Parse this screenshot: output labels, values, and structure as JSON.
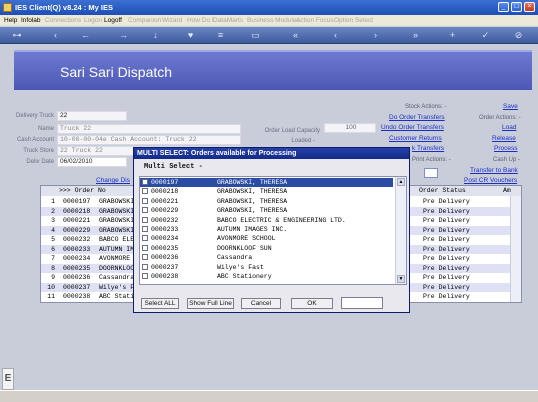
{
  "window": {
    "title": "IES Client(Q) v8.24 : My IES"
  },
  "menu": [
    {
      "label": "Help",
      "enabled": true
    },
    {
      "label": "Infolab",
      "enabled": true
    },
    {
      "label": "Connections",
      "enabled": false
    },
    {
      "label": "Logon",
      "enabled": false
    },
    {
      "label": "Logoff",
      "enabled": true
    },
    {
      "label": "Companion",
      "enabled": false
    },
    {
      "label": "Wizard",
      "enabled": false
    },
    {
      "label": "How Do I",
      "enabled": false
    },
    {
      "label": "DataMarts",
      "enabled": false
    },
    {
      "label": "Business Modules",
      "enabled": false
    },
    {
      "label": "Action Focus",
      "enabled": false
    },
    {
      "label": "Option Select",
      "enabled": false
    }
  ],
  "page": {
    "title": "Sari Sari Dispatch"
  },
  "form": {
    "delivery_truck_label": "Delivery Truck",
    "delivery_truck_value": "22",
    "name_label": "Name",
    "name_value": "Truck 22",
    "cash_account_label": "Cash Account",
    "cash_account_value": "10-00-00-04e Cash Account: Truck 22",
    "truck_store_label": "Truck Store",
    "truck_store_value": "22 Truck 22",
    "date_label": "Deliv Date",
    "date_value": "06/02/2010",
    "change_link": "Change Dis",
    "capacity_label": "Order Load Capacity",
    "capacity_value": "100",
    "loaded_label": "Loaded -"
  },
  "right_panel": {
    "save": "Save",
    "stock_actions": "Stock Actions: -",
    "do_order_transfers": "Do Order Transfers",
    "order_actions": "Order Actions: -",
    "undo_order_transfers": "Undo Order Transfers",
    "load": "Load",
    "customer_returns": "Customer Returns",
    "release": "Release",
    "k_transfers": "k Transfers",
    "process": "Process",
    "print_actions": "Print Actions: -",
    "cash_up": "Cash Up -",
    "transfer_to_bank": "Transfer to Bank",
    "post_cr_vouchers": "Post CR Vouchers"
  },
  "grid": {
    "headers": {
      "order_no": ">>> Order No",
      "order_status": "Order Status",
      "am": "Am"
    },
    "rows": [
      {
        "n": "1",
        "order": "0000197",
        "customer": "GRABOWSKI,",
        "status": "Pre Delivery"
      },
      {
        "n": "2",
        "order": "0000218",
        "customer": "GRABOWSKI,",
        "status": "Pre Delivery"
      },
      {
        "n": "3",
        "order": "0000221",
        "customer": "GRABOWSKI,",
        "status": "Pre Delivery"
      },
      {
        "n": "4",
        "order": "0000229",
        "customer": "GRABOWSKI,",
        "status": "Pre Delivery"
      },
      {
        "n": "5",
        "order": "0000232",
        "customer": "BABCO ELECT",
        "status": "Pre Delivery"
      },
      {
        "n": "6",
        "order": "0000233",
        "customer": "AUTUMN IMAG",
        "status": "Pre Delivery"
      },
      {
        "n": "7",
        "order": "0000234",
        "customer": "AVONMORE SC",
        "status": "Pre Delivery"
      },
      {
        "n": "8",
        "order": "0000235",
        "customer": "DOORNKLOOF",
        "status": "Pre Delivery"
      },
      {
        "n": "9",
        "order": "0000236",
        "customer": "Cassandra",
        "status": "Pre Delivery"
      },
      {
        "n": "10",
        "order": "0000237",
        "customer": "Wilye's Fas",
        "status": "Pre Delivery"
      },
      {
        "n": "11",
        "order": "0000238",
        "customer": "ABC Station",
        "status": "Pre Delivery"
      }
    ]
  },
  "dialog": {
    "title": "MULTI SELECT: Orders available for Processing",
    "subtitle": "Multi Select -",
    "items": [
      {
        "code": "0000197",
        "name": "GRABOWSKI, THERESA",
        "selected": true
      },
      {
        "code": "0000218",
        "name": "GRABOWSKI, THERESA",
        "selected": false
      },
      {
        "code": "0000221",
        "name": "GRABOWSKI, THERESA",
        "selected": false
      },
      {
        "code": "0000229",
        "name": "GRABOWSKI, THERESA",
        "selected": false
      },
      {
        "code": "0000232",
        "name": "BABCO ELECTRIC & ENGINEERING LTD.",
        "selected": false
      },
      {
        "code": "0000233",
        "name": "AUTUMN IMAGES INC.",
        "selected": false
      },
      {
        "code": "0000234",
        "name": "AVONMORE SCHOOL",
        "selected": false
      },
      {
        "code": "0000235",
        "name": "DOORNKLOOF SUN",
        "selected": false
      },
      {
        "code": "0000236",
        "name": "Cassandra",
        "selected": false
      },
      {
        "code": "0000237",
        "name": "Wilye's Fast",
        "selected": false
      },
      {
        "code": "0000238",
        "name": "ABC Stationery",
        "selected": false
      }
    ],
    "buttons": {
      "select_all": "Select ALL",
      "show_full_line": "Show Full Line",
      "cancel": "Cancel",
      "ok": "OK"
    }
  },
  "status": {
    "left_glyph": "E"
  },
  "colors": {
    "banner": "#5360bd",
    "dialog_title": "#1b3495",
    "selection": "#2b4ca3",
    "link": "#1b2ec8"
  }
}
